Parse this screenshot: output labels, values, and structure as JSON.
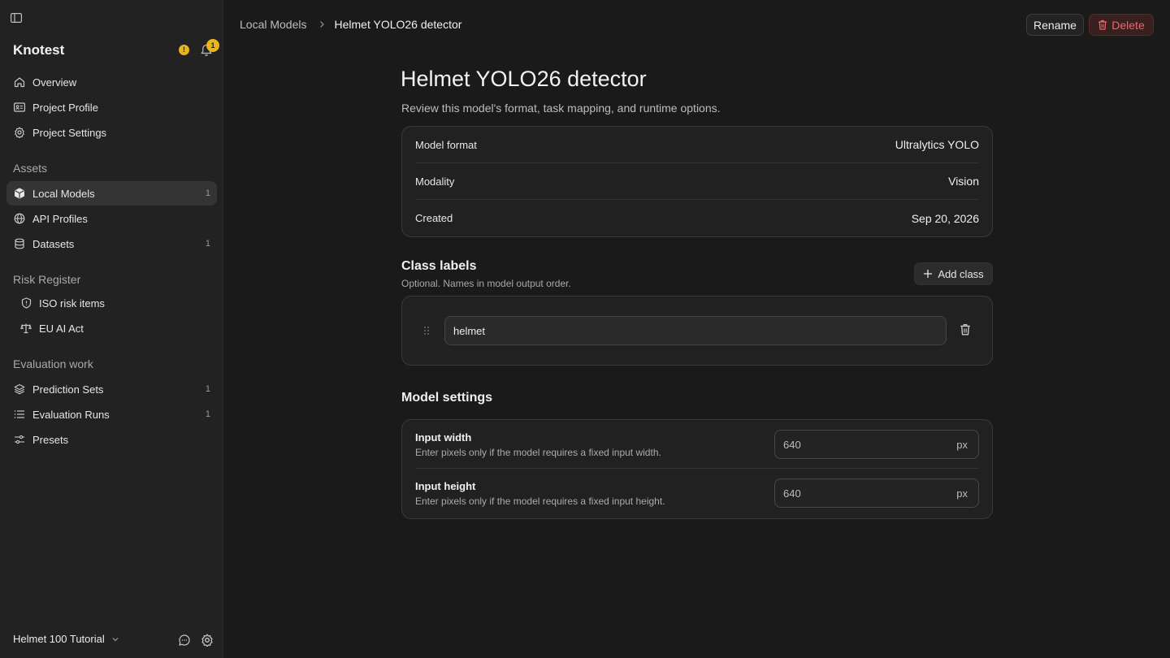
{
  "sidebar": {
    "brand": "Knotest",
    "warning_badge": "!",
    "notification_count": "1",
    "top_items": [
      {
        "label": "Overview",
        "icon": "home-icon"
      },
      {
        "label": "Project Profile",
        "icon": "id-card-icon"
      },
      {
        "label": "Project Settings",
        "icon": "gear-icon"
      }
    ],
    "sections": {
      "assets": "Assets",
      "risk": "Risk Register",
      "evaluation": "Evaluation work"
    },
    "assets_items": [
      {
        "label": "Local Models",
        "count": "1",
        "icon": "cube-icon",
        "active": true
      },
      {
        "label": "API Profiles",
        "count": "",
        "icon": "globe-icon"
      },
      {
        "label": "Datasets",
        "count": "1",
        "icon": "database-icon"
      }
    ],
    "risk_items": [
      {
        "label": "ISO risk items",
        "icon": "shield-icon"
      },
      {
        "label": "EU AI Act",
        "icon": "scale-icon"
      }
    ],
    "evaluation_items": [
      {
        "label": "Prediction Sets",
        "count": "1",
        "icon": "layers-icon"
      },
      {
        "label": "Evaluation Runs",
        "count": "1",
        "icon": "list-icon"
      },
      {
        "label": "Presets",
        "count": "",
        "icon": "sliders-icon"
      }
    ],
    "workspace": "Helmet 100 Tutorial"
  },
  "header": {
    "breadcrumb_parent": "Local Models",
    "breadcrumb_current": "Helmet YOLO26 detector",
    "rename_label": "Rename",
    "delete_label": "Delete"
  },
  "main": {
    "title": "Helmet YOLO26 detector",
    "subtitle": "Review this model's format, task mapping, and runtime options.",
    "info": [
      {
        "label": "Model format",
        "value": "Ultralytics YOLO"
      },
      {
        "label": "Modality",
        "value": "Vision"
      },
      {
        "label": "Created",
        "value": "Sep 20, 2026"
      }
    ],
    "class_labels": {
      "title": "Class labels",
      "subtitle": "Optional. Names in model output order.",
      "add_label": "Add class",
      "items": [
        "helmet"
      ]
    },
    "settings": {
      "title": "Model settings",
      "rows": [
        {
          "title": "Input width",
          "desc": "Enter pixels only if the model requires a fixed input width.",
          "value": "640",
          "unit": "px"
        },
        {
          "title": "Input height",
          "desc": "Enter pixels only if the model requires a fixed input height.",
          "value": "640",
          "unit": "px"
        }
      ]
    }
  },
  "colors": {
    "accent_warning": "#e8b51f",
    "danger": "#e86a6a",
    "background": "#1a1a1a",
    "sidebar": "#222222"
  }
}
